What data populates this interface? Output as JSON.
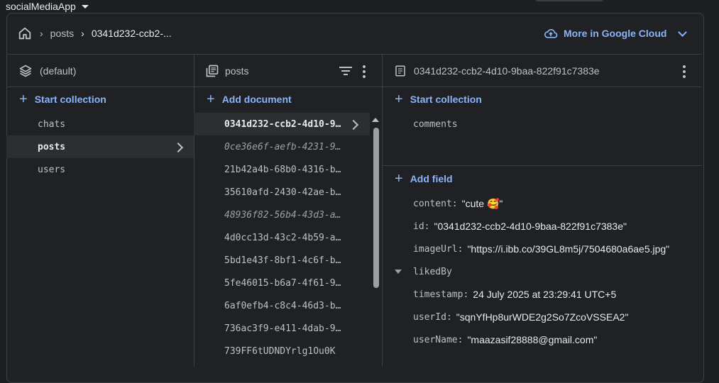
{
  "project": {
    "name": "socialMediaApp"
  },
  "breadcrumb": {
    "collection": "posts",
    "document": "0341d232-ccb2-..."
  },
  "header": {
    "more_cloud_label": "More in Google Cloud"
  },
  "database_column": {
    "title": "(default)",
    "start_collection_label": "Start collection",
    "collections": [
      "chats",
      "posts",
      "users"
    ],
    "selected": "posts"
  },
  "collection_column": {
    "title": "posts",
    "add_document_label": "Add document",
    "documents": [
      "0341d232-ccb2-4d10-9…",
      "0ce36e6f-aefb-4231-9…",
      "21b42a4b-68b0-4316-b…",
      "35610afd-2430-42ae-b…",
      "48936f82-56b4-43d3-a…",
      "4d0cc13d-43c2-4b59-a…",
      "5bd1e43f-8bf1-4c6f-b…",
      "5fe46015-b6a7-4f61-9…",
      "6af0efb4-c8c4-46d3-b…",
      "736ac3f9-e411-4dab-9…",
      "739FF6tUDNDYrlg1Ou0K"
    ],
    "italic_indices": [
      1,
      4
    ]
  },
  "document_column": {
    "title": "0341d232-ccb2-4d10-9baa-822f91c7383e",
    "start_collection_label": "Start collection",
    "subcollections": [
      "comments"
    ],
    "add_field_label": "Add field",
    "fields": [
      {
        "key": "content:",
        "value": "\"cute 🥰\""
      },
      {
        "key": "id:",
        "value": "\"0341d232-ccb2-4d10-9baa-822f91c7383e\""
      },
      {
        "key": "imageUrl:",
        "value": "\"https://i.ibb.co/39GL8m5j/7504680a6ae5.jpg\""
      },
      {
        "key": "likedBy",
        "value": ""
      },
      {
        "key": "timestamp:",
        "value": "24 July 2025 at 23:29:41 UTC+5"
      },
      {
        "key": "userId:",
        "value": "\"sqnYfHp8urWDE2g2So7ZcoVSSEA2\""
      },
      {
        "key": "userName:",
        "value": "\"maazasif28888@gmail.com\""
      }
    ]
  },
  "colors": {
    "accent": "#8ab4f8",
    "background": "#202124",
    "selected": "#2d2e30"
  }
}
